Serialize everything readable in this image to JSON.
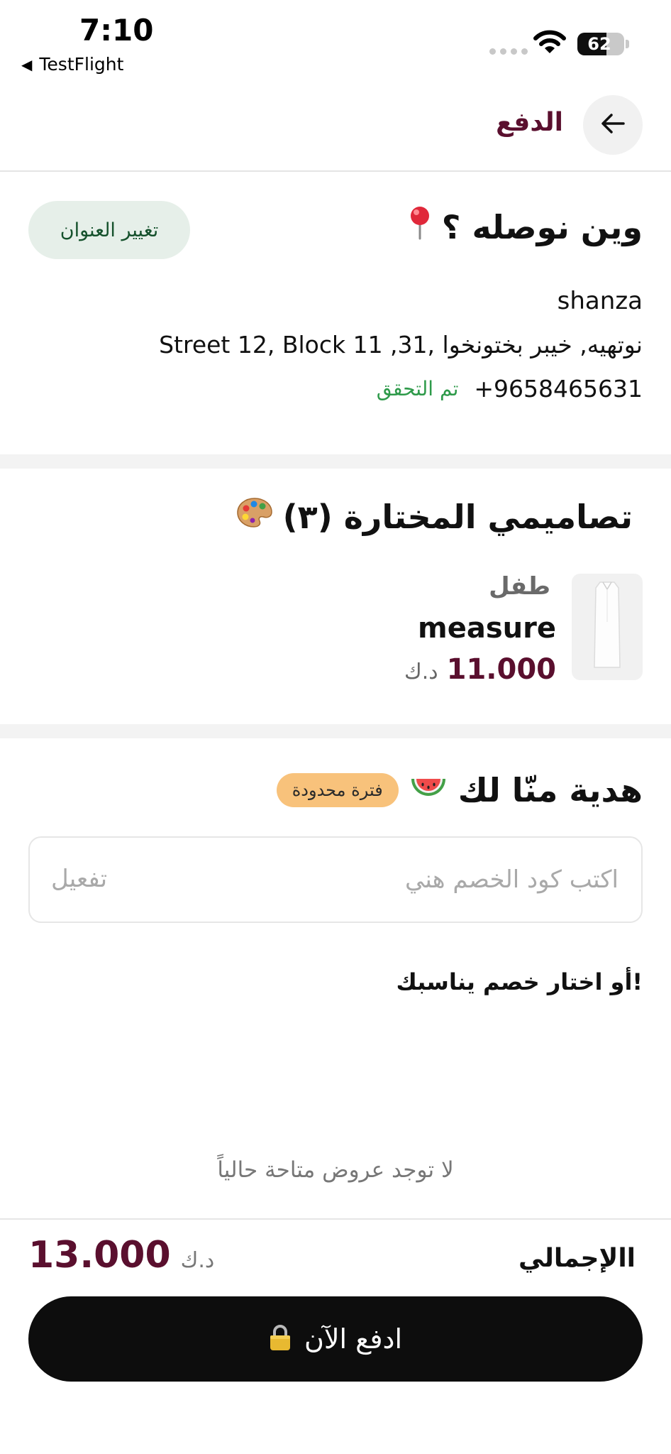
{
  "status_bar": {
    "time": "7:10",
    "back_app": "TestFlight",
    "battery": "62",
    "battery_level": 0.62
  },
  "header": {
    "title": "الدفع",
    "back_icon": "arrow-left-icon"
  },
  "address": {
    "title": "وين نوصله ؟",
    "pin_icon": "pushpin-icon",
    "change_button": "تغيير العنوان",
    "name": "shanza",
    "line": "نوتهيه, خيبر بختونخوا ,31, Street 12, Block 11",
    "phone": "+9658465631",
    "verified": "تم التحقق"
  },
  "designs": {
    "title": "تصاميمي المختارة (٣)",
    "palette_icon": "palette-icon",
    "item": {
      "category": "طفل",
      "name": "measure",
      "price": "11.000",
      "currency": "د.ك"
    }
  },
  "gift": {
    "title": "هدية منّا لك",
    "watermelon_icon": "watermelon-icon",
    "badge": "فترة محدودة",
    "promo_placeholder": "اكتب كود الخصم هني",
    "activate": "تفعيل",
    "or_choose": "!أو اختار خصم يناسبك",
    "no_offers": "لا توجد عروض متاحة حالياً"
  },
  "footer": {
    "total_label": "االإجمالي",
    "total_value": "13.000",
    "currency": "د.ك",
    "pay_button": "ادفع الآن",
    "lock_icon": "lock-icon"
  },
  "colors": {
    "brand": "#5a0f2e",
    "verified": "#2e9a4a",
    "badge": "#f8c27b",
    "button": "#0d0d0d"
  }
}
